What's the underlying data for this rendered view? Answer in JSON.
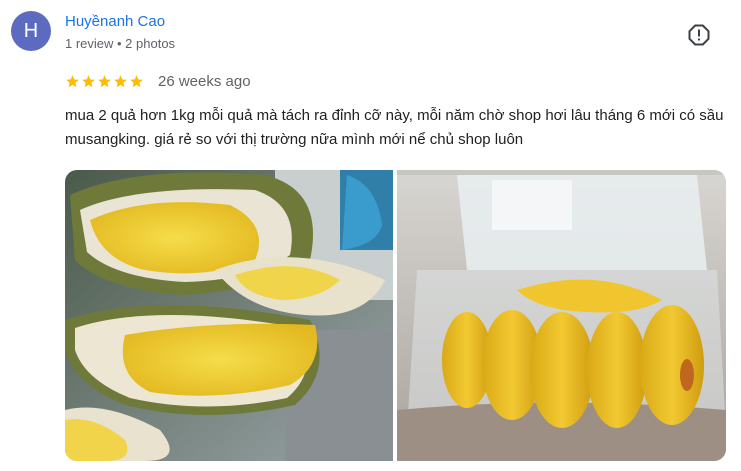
{
  "reviewer": {
    "initial": "H",
    "name": "Huyềnanh Cao",
    "meta": "1 review • 2 photos"
  },
  "review": {
    "rating": 5,
    "date": "26 weeks ago",
    "text": "mua 2 quả hơn 1kg mỗi quả mà tách ra đỉnh cỡ này, mỗi năm chờ shop hơi lâu tháng 6 mới có sầu musangking. giá rẻ so với thị trường nữa mình mới nể chủ shop luôn"
  },
  "colors": {
    "name_link": "#1a73e8",
    "avatar_bg": "#5c6bc0",
    "star": "#fbbc04",
    "secondary_text": "#5f6368"
  },
  "icons": {
    "report": "report-flag-icon",
    "star": "star-icon"
  }
}
